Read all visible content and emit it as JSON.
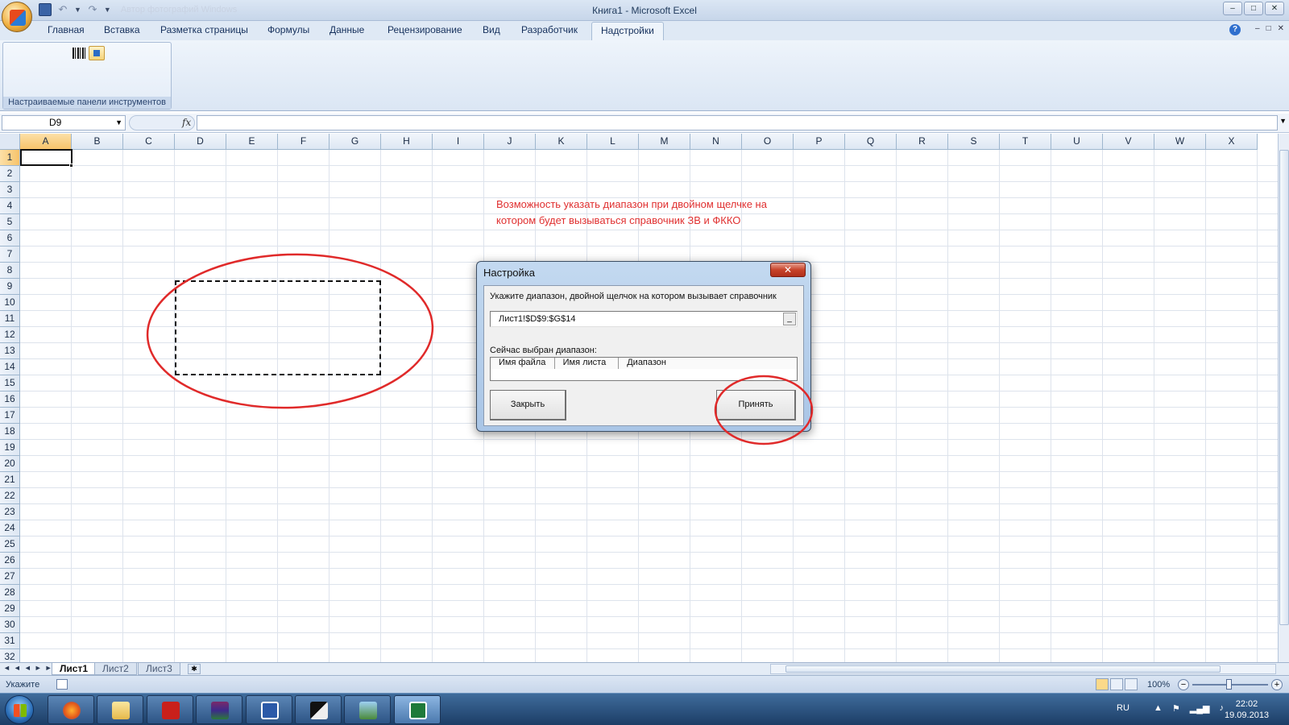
{
  "window": {
    "title": "Книга1 - Microsoft Excel",
    "faded_caption": "Автор фотографий Windows",
    "controls": [
      "–",
      "□",
      "✕"
    ],
    "mdi_controls": [
      "–",
      "□",
      "✕"
    ],
    "help_glyph": "?"
  },
  "ribbon": {
    "tabs": [
      "Главная",
      "Вставка",
      "Разметка страницы",
      "Формулы",
      "Данные",
      "Рецензирование",
      "Вид",
      "Разработчик",
      "Надстройки"
    ],
    "active_tab": "Надстройки",
    "group_label": "Настраиваемые панели инструментов",
    "icons": [
      "barcode-icon",
      "addin-icon"
    ]
  },
  "formula_bar": {
    "name_box": "D9",
    "fx": "fx",
    "value": ""
  },
  "grid": {
    "columns": [
      "A",
      "B",
      "C",
      "D",
      "E",
      "F",
      "G",
      "H",
      "I",
      "J",
      "K",
      "L",
      "M",
      "N",
      "O",
      "P",
      "Q",
      "R",
      "S",
      "T",
      "U",
      "V",
      "W",
      "X"
    ],
    "rows": [
      "1",
      "2",
      "3",
      "4",
      "5",
      "6",
      "7",
      "8",
      "9",
      "10",
      "11",
      "12",
      "13",
      "14",
      "15",
      "16",
      "17",
      "18",
      "19",
      "20",
      "21",
      "22",
      "23",
      "24",
      "25",
      "26",
      "27",
      "28",
      "29",
      "30",
      "31",
      "32"
    ],
    "active_cell": "A1",
    "copy_range": "D9:G14"
  },
  "annotation": {
    "line1": "Возможность указать диапазон при двойном щелчке на",
    "line2": "котором будет вызываться справочник ЗВ и ФККО",
    "color": "#e03030"
  },
  "dialog": {
    "title": "Настройка",
    "close_glyph": "✕",
    "prompt": "Укажите диапазон, двойной щелчок на котором вызывает справочник",
    "range_value": "Лист1!$D$9:$G$14",
    "range_btn": "_",
    "selected_label": "Сейчас выбран диапазон:",
    "list_columns": [
      "Имя файла",
      "Имя листа",
      "Диапазон"
    ],
    "close_button": "Закрыть",
    "accept_button": "Принять"
  },
  "sheets": {
    "nav": "◄◄◄►►►",
    "tabs": [
      "Лист1",
      "Лист2",
      "Лист3"
    ],
    "active": "Лист1",
    "new_sheet_glyph": "✱"
  },
  "status": {
    "mode": "Укажите",
    "zoom": "100%",
    "zoom_minus": "−",
    "zoom_plus": "+"
  },
  "taskbar": {
    "apps": [
      "firefox-icon",
      "explorer-icon",
      "acrobat-icon",
      "winrar-icon",
      "word-icon",
      "inkscape-icon",
      "photo-viewer-icon",
      "excel-icon"
    ],
    "lang": "RU",
    "tray": [
      "▲",
      "⚑",
      "▂▄▆",
      "♪"
    ],
    "time": "22:02",
    "date": "19.09.2013"
  }
}
